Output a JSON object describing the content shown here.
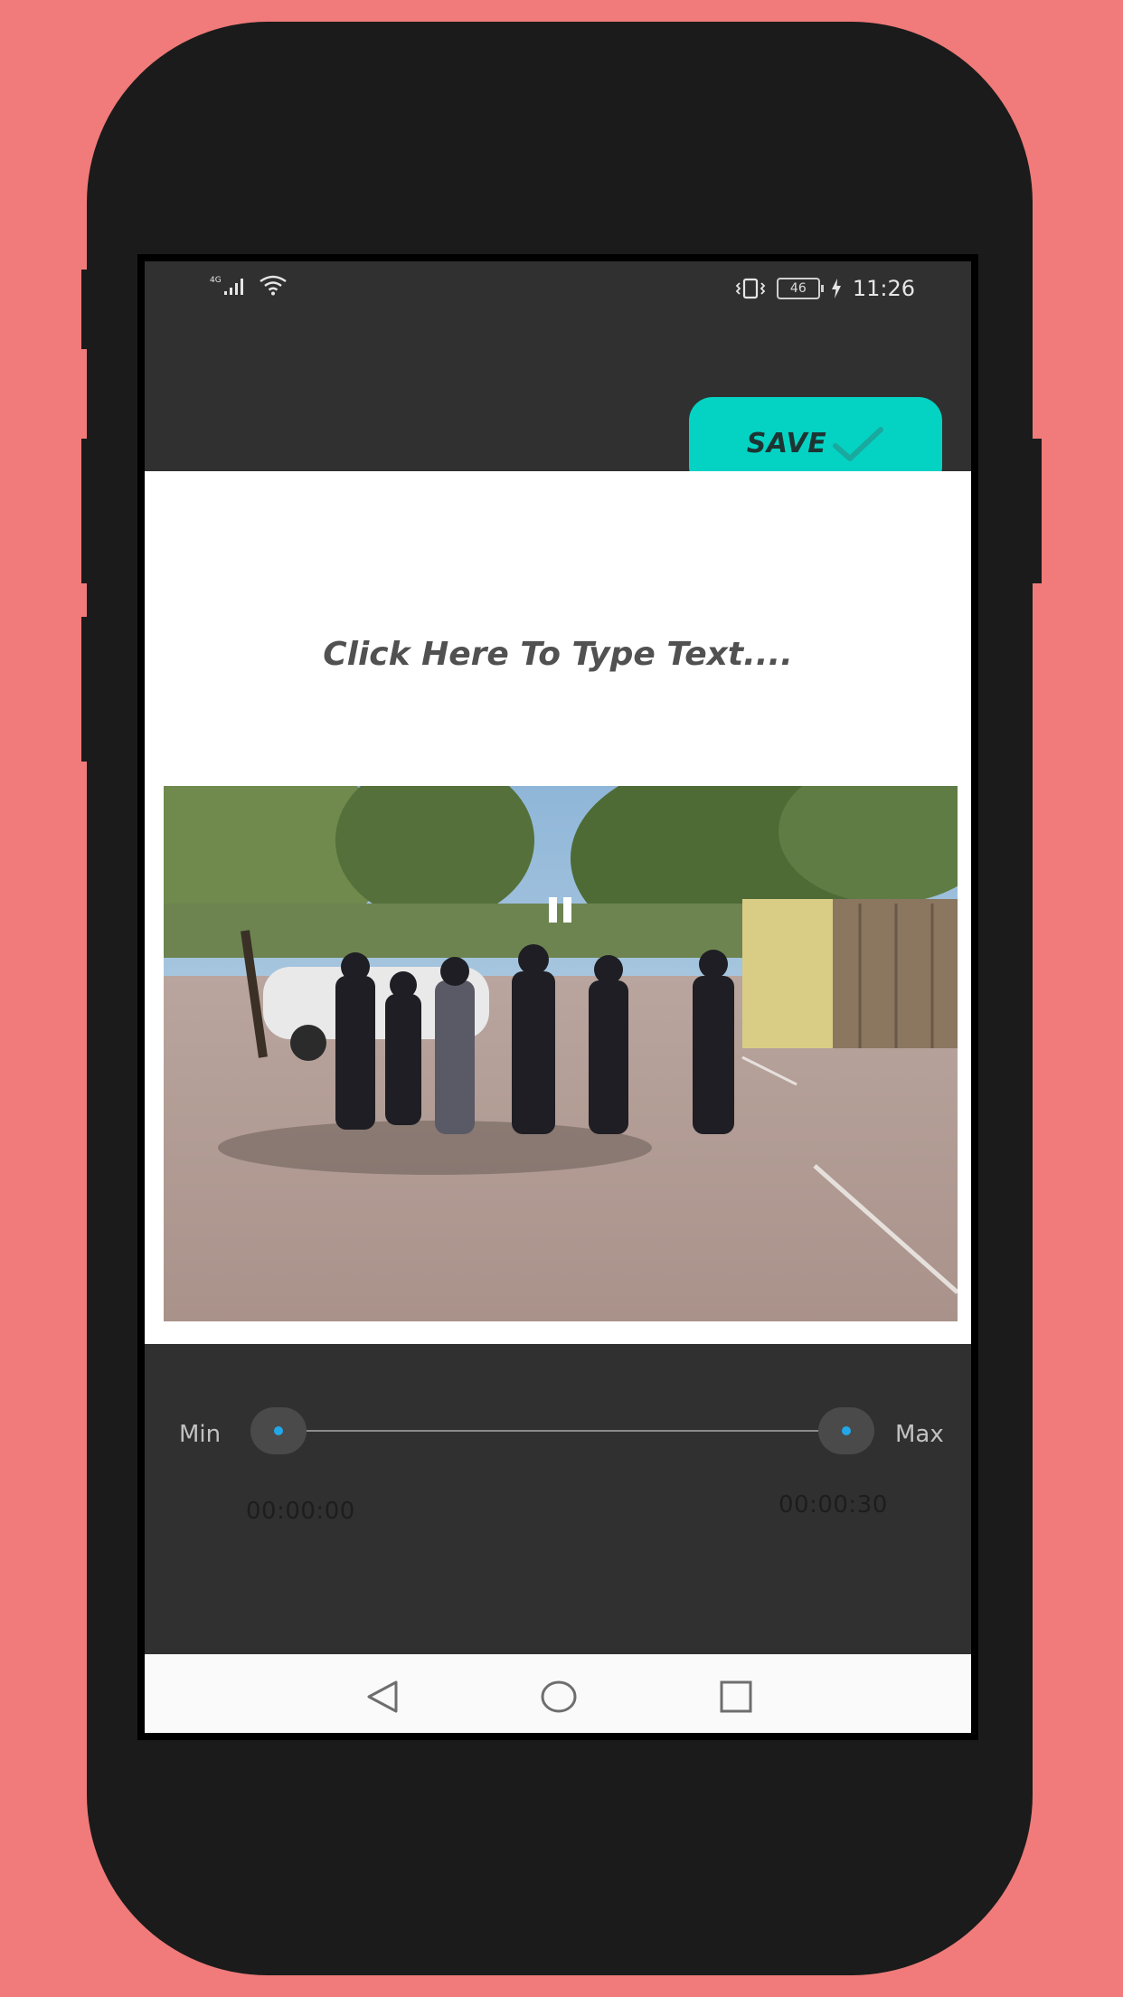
{
  "status_bar": {
    "network": "4G",
    "battery_level": "46",
    "time": "11:26"
  },
  "toolbar": {
    "save_label": "SAVE"
  },
  "editor": {
    "text_prompt": "Click Here To Type Text...."
  },
  "trim": {
    "min_label": "Min",
    "max_label": "Max",
    "start_time": "00:00:00",
    "end_time": "00:00:30",
    "start_fraction": 0.0,
    "end_fraction": 1.0
  },
  "colors": {
    "page_background": "#F07B7A",
    "phone_body": "#1B1B1B",
    "app_background": "#303030",
    "save_button": "#04D3C3",
    "slider_thumb": "#22A7E8"
  },
  "icons": {
    "save": "check-icon",
    "video": "pause-icon",
    "nav": [
      "back-icon",
      "home-icon",
      "recents-icon"
    ]
  }
}
